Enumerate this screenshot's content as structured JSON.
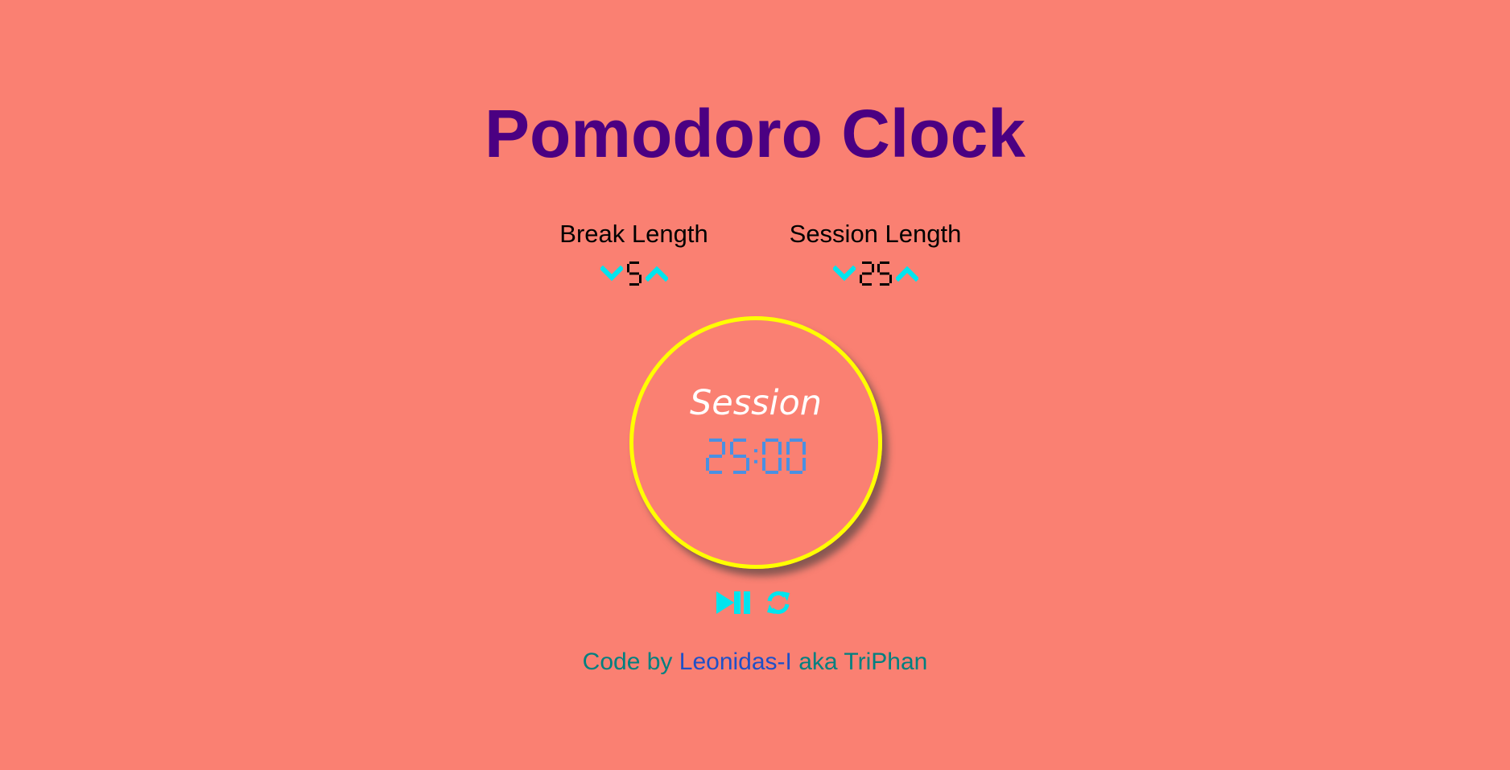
{
  "title": "Pomodoro Clock",
  "break_setting": {
    "label": "Break Length",
    "value": "5",
    "decrement_icon": "chevron-down-icon",
    "increment_icon": "chevron-up-icon"
  },
  "session_setting": {
    "label": "Session Length",
    "value": "25",
    "decrement_icon": "chevron-down-icon",
    "increment_icon": "chevron-up-icon"
  },
  "timer": {
    "label": "Session",
    "time_left": "25:00"
  },
  "controls": {
    "play_pause_icon": "play-pause-icon",
    "reset_icon": "refresh-icon"
  },
  "footer": {
    "prefix": "Code by",
    "author_link": "Leonidas-I",
    "suffix": "aka TriPhan"
  },
  "colors": {
    "background": "#fa8072",
    "title": "#4b0082",
    "accent_cyan": "#00e5ee",
    "clock_border": "#ffff00",
    "timer_digits": "#4a90e2",
    "setting_digits": "#000000",
    "timer_label": "#ffffff",
    "footer_text": "#008080",
    "footer_link": "#1e50c8"
  }
}
